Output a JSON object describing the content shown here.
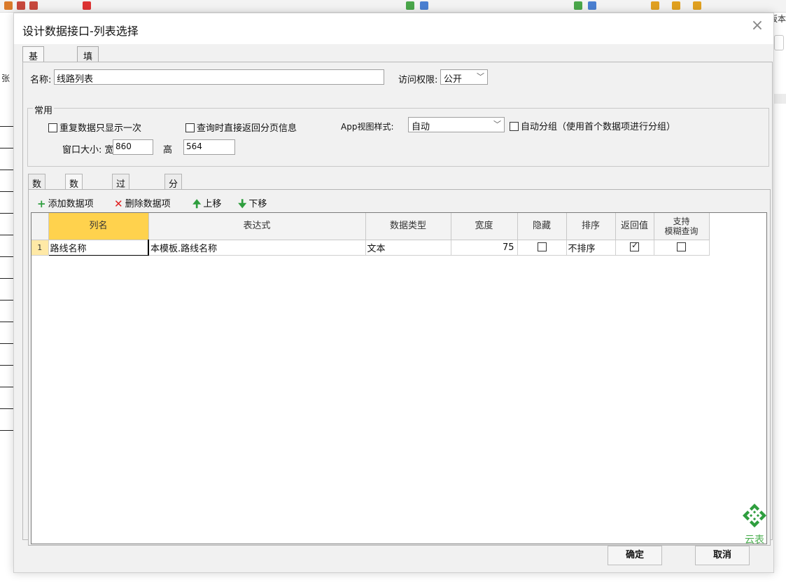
{
  "background": {
    "right_text": "板本",
    "left_text": "张"
  },
  "dialog": {
    "title": "设计数据接口-列表选择",
    "close_glyph": "×",
    "tabs": [
      {
        "label": "基本设置",
        "active": true
      },
      {
        "label": "填表公式",
        "active": false
      }
    ],
    "name_label": "名称:",
    "name_value": "线路列表",
    "access_label": "访问权限:",
    "access_value": "公开",
    "group_title": "常用",
    "options": {
      "repeat_once": {
        "label": "重复数据只显示一次",
        "checked": false
      },
      "return_paging": {
        "label": "查询时直接返回分页信息",
        "checked": false
      },
      "app_view_label": "App视图样式:",
      "app_view_value": "自动",
      "auto_group": {
        "label": "自动分组（使用首个数据项进行分组）",
        "checked": false
      }
    },
    "window_size_label": "窗口大小: 宽",
    "window_width": "860",
    "height_label": "高",
    "window_height": "564",
    "sub_tabs": [
      {
        "label": "数据源",
        "active": false
      },
      {
        "label": "数据列",
        "active": true
      },
      {
        "label": "过滤条件",
        "active": false
      },
      {
        "label": "分类树",
        "active": false
      }
    ],
    "toolbar": {
      "add": "添加数据项",
      "delete": "删除数据项",
      "up": "上移",
      "down": "下移"
    },
    "grid": {
      "headers": [
        "列名",
        "表达式",
        "数据类型",
        "宽度",
        "隐藏",
        "排序",
        "返回值",
        "支持\n模糊查询"
      ],
      "rows": [
        {
          "num": "1",
          "col_name": "路线名称",
          "expression": "本模板.路线名称",
          "data_type": "文本",
          "width": "75",
          "hidden": false,
          "sort": "不排序",
          "return_value": true,
          "fuzzy": false
        }
      ]
    },
    "logo_text": "云表",
    "colors": {
      "logo": "#2e9e3e",
      "key_header": "#ffd24d",
      "row_marker": "#ffe9a6"
    },
    "ok_label": "确定",
    "cancel_label": "取消"
  }
}
